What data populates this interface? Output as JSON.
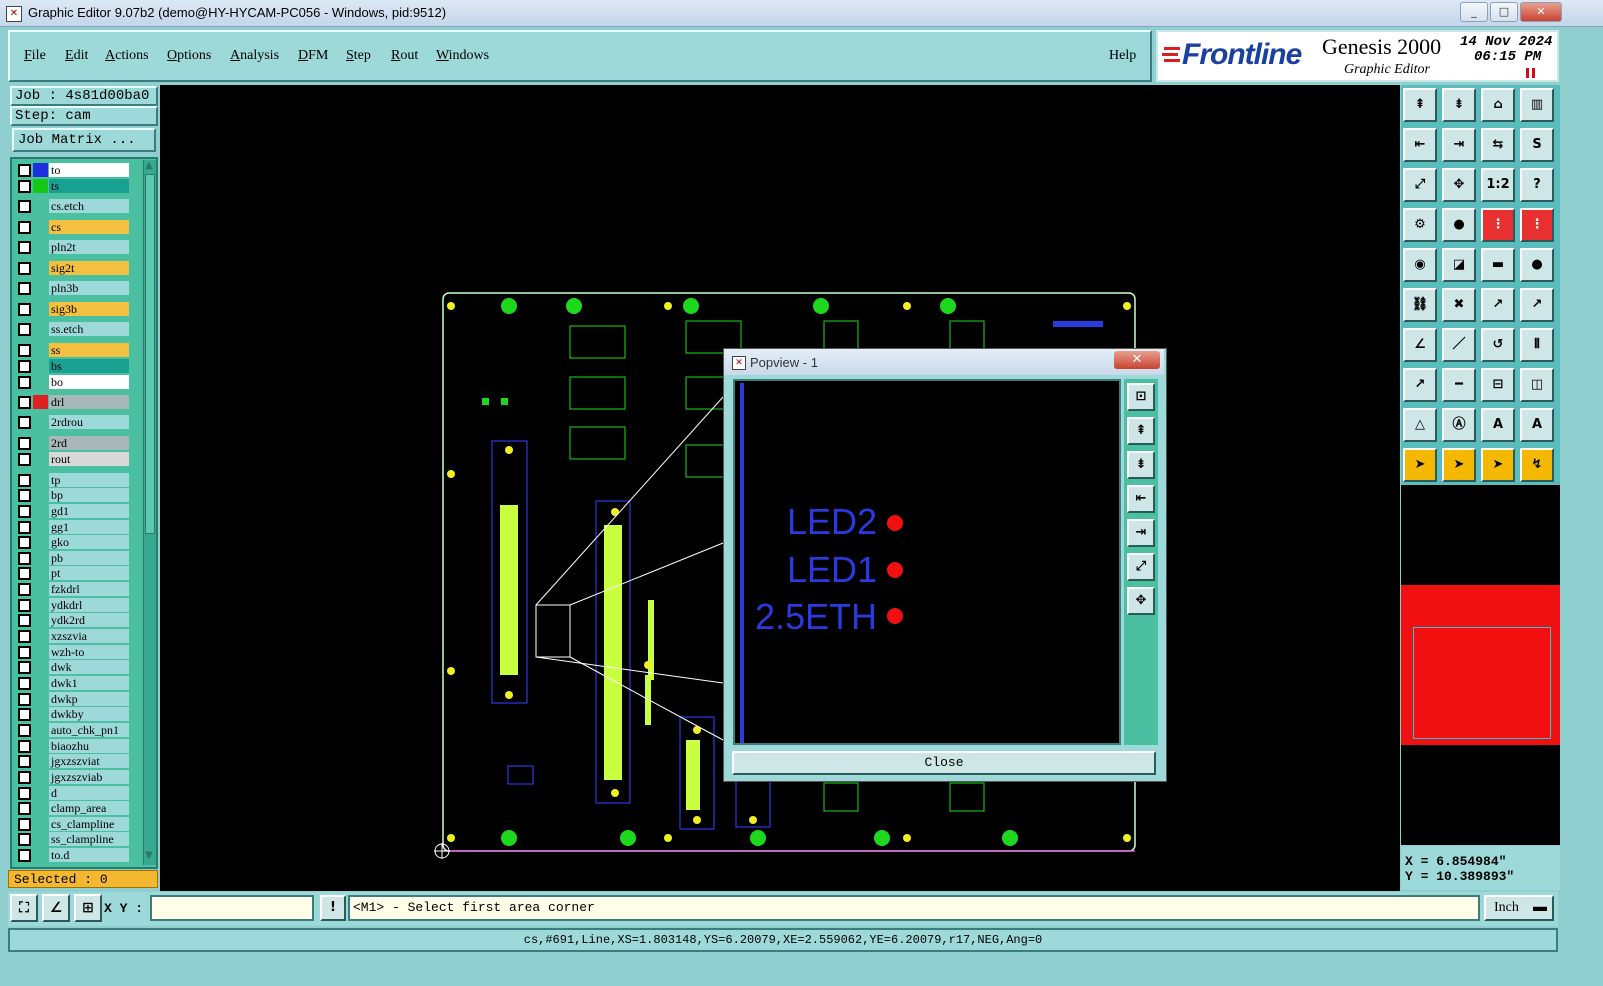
{
  "window": {
    "title": "Graphic Editor 9.07b2 (demo@HY-HYCAM-PC056 - Windows, pid:9512)",
    "minimize": "_",
    "maximize": "□",
    "close": "✕"
  },
  "menu": {
    "items": [
      "File",
      "Edit",
      "Actions",
      "Options",
      "Analysis",
      "DFM",
      "Step",
      "Rout",
      "Windows"
    ],
    "help": "Help"
  },
  "brand": {
    "logo": "Frontline",
    "product": "Genesis 2000",
    "subtitle": "Graphic Editor",
    "date": "14 Nov 2024",
    "time": "06:15 PM"
  },
  "left": {
    "job": "Job : 4s81d00ba0",
    "step": "Step: cam",
    "job_matrix": "Job Matrix ...",
    "selected": "Selected : 0"
  },
  "layers": [
    {
      "name": "to",
      "color": "#1f2fe0",
      "bg": "#ffffff"
    },
    {
      "name": "ts",
      "color": "#14c814",
      "bg": "#18a090"
    },
    {
      "name": "cs.etch",
      "color": "",
      "bg": "#9ed9d9"
    },
    {
      "name": "cs",
      "color": "",
      "bg": "#f4c040"
    },
    {
      "name": "pln2t",
      "color": "",
      "bg": "#9ed9d9"
    },
    {
      "name": "sig2t",
      "color": "",
      "bg": "#f4c040"
    },
    {
      "name": "pln3b",
      "color": "",
      "bg": "#9ed9d9"
    },
    {
      "name": "sig3b",
      "color": "",
      "bg": "#f4c040"
    },
    {
      "name": "ss.etch",
      "color": "",
      "bg": "#9ed9d9"
    },
    {
      "name": "ss",
      "color": "",
      "bg": "#f4c040"
    },
    {
      "name": "bs",
      "color": "",
      "bg": "#18a090"
    },
    {
      "name": "bo",
      "color": "",
      "bg": "#ffffff"
    },
    {
      "name": "drl",
      "color": "#e02020",
      "bg": "#a8b8b8"
    },
    {
      "name": "2rdrou",
      "color": "",
      "bg": "#9ed9d9"
    },
    {
      "name": "2rd",
      "color": "",
      "bg": "#a8b8b8"
    },
    {
      "name": "rout",
      "color": "",
      "bg": "#d8d8d8"
    },
    {
      "name": "tp",
      "color": "",
      "bg": "#9ed9d9"
    },
    {
      "name": "bp",
      "color": "",
      "bg": "#9ed9d9"
    },
    {
      "name": "gd1",
      "color": "",
      "bg": "#9ed9d9"
    },
    {
      "name": "gg1",
      "color": "",
      "bg": "#9ed9d9"
    },
    {
      "name": "gko",
      "color": "",
      "bg": "#9ed9d9"
    },
    {
      "name": "pb",
      "color": "",
      "bg": "#9ed9d9"
    },
    {
      "name": "pt",
      "color": "",
      "bg": "#9ed9d9"
    },
    {
      "name": "fzkdrl",
      "color": "",
      "bg": "#9ed9d9"
    },
    {
      "name": "ydkdrl",
      "color": "",
      "bg": "#9ed9d9"
    },
    {
      "name": "ydk2rd",
      "color": "",
      "bg": "#9ed9d9"
    },
    {
      "name": "xzszvia",
      "color": "",
      "bg": "#9ed9d9"
    },
    {
      "name": "wzh-to",
      "color": "",
      "bg": "#9ed9d9"
    },
    {
      "name": "dwk",
      "color": "",
      "bg": "#9ed9d9"
    },
    {
      "name": "dwk1",
      "color": "",
      "bg": "#9ed9d9"
    },
    {
      "name": "dwkp",
      "color": "",
      "bg": "#9ed9d9"
    },
    {
      "name": "dwkby",
      "color": "",
      "bg": "#9ed9d9"
    },
    {
      "name": "auto_chk_pn1",
      "color": "",
      "bg": "#9ed9d9"
    },
    {
      "name": "biaozhu",
      "color": "",
      "bg": "#9ed9d9"
    },
    {
      "name": "jgxzszviat",
      "color": "",
      "bg": "#9ed9d9"
    },
    {
      "name": "jgxzszviab",
      "color": "",
      "bg": "#9ed9d9"
    },
    {
      "name": "d",
      "color": "",
      "bg": "#9ed9d9"
    },
    {
      "name": "clamp_area",
      "color": "",
      "bg": "#9ed9d9"
    },
    {
      "name": "cs_clampline",
      "color": "",
      "bg": "#9ed9d9"
    },
    {
      "name": "ss_clampline",
      "color": "",
      "bg": "#9ed9d9"
    },
    {
      "name": "to.d",
      "color": "",
      "bg": "#9ed9d9"
    }
  ],
  "popview": {
    "title": "Popview - 1",
    "close": "Close",
    "labels": [
      "LED2",
      "LED1",
      "2.5ETH"
    ]
  },
  "coords": {
    "x": "X =  6.854984\"",
    "y": "Y = 10.389893\""
  },
  "status": {
    "xy_label": "X Y :",
    "xy_value": "",
    "prompt": "<M1> - Select first area corner",
    "units": "Inch",
    "info": "cs,#691,Line,XS=1.803148,YS=6.20079,XE=2.559062,YE=6.20079,r17,NEG,Ang=0"
  },
  "toolbar_icons": [
    "layer-up-icon",
    "layer-down-icon",
    "home-icon",
    "panel-icon",
    "move-left-icon",
    "move-right-icon",
    "swap-icon",
    "snake-icon",
    "zoom-fit-icon",
    "zoom-in-icon",
    "scale-icon",
    "help-icon",
    "tools-icon",
    "probe-icon",
    "net-icon",
    "net2-icon",
    "select-icon",
    "highlight-icon",
    "ruler-icon",
    "pad-icon",
    "connect-icon",
    "cross-icon",
    "line-icon",
    "line2-icon",
    "angle-icon",
    "slash-icon",
    "arc-icon",
    "parallel-icon",
    "move-pad-icon",
    "minus-icon",
    "measure-icon",
    "copy-icon",
    "triangle-icon",
    "triangle-a-icon",
    "triangle-b-icon",
    "triangle-c-icon",
    "pointer-icon",
    "pointer2-icon",
    "pointer3-icon",
    "route-icon"
  ]
}
